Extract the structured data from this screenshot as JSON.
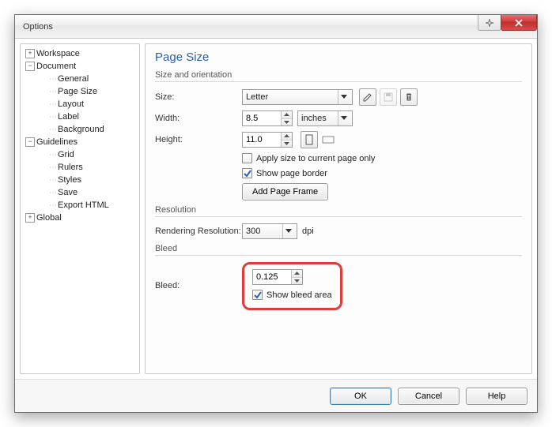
{
  "window": {
    "title": "Options"
  },
  "tree": {
    "workspace": {
      "label": "Workspace",
      "expanded": false
    },
    "document": {
      "label": "Document",
      "expanded": true,
      "children": [
        {
          "key": "general",
          "label": "General"
        },
        {
          "key": "page_size",
          "label": "Page Size"
        },
        {
          "key": "layout",
          "label": "Layout"
        },
        {
          "key": "label",
          "label": "Label"
        },
        {
          "key": "background",
          "label": "Background"
        }
      ]
    },
    "guidelines": {
      "label": "Guidelines",
      "expanded": true,
      "children": [
        {
          "key": "grid",
          "label": "Grid"
        },
        {
          "key": "rulers",
          "label": "Rulers"
        },
        {
          "key": "styles",
          "label": "Styles"
        },
        {
          "key": "save",
          "label": "Save"
        },
        {
          "key": "export_html",
          "label": "Export HTML"
        }
      ]
    },
    "global": {
      "label": "Global",
      "expanded": false
    }
  },
  "page": {
    "title": "Page Size",
    "size_group": "Size and orientation",
    "size_label": "Size:",
    "size_value": "Letter",
    "width_label": "Width:",
    "width_value": "8.5",
    "units_value": "inches",
    "height_label": "Height:",
    "height_value": "11.0",
    "apply_current_label": "Apply size to current page only",
    "apply_current_checked": false,
    "show_border_label": "Show page border",
    "show_border_checked": true,
    "add_frame_label": "Add Page Frame",
    "resolution_group": "Resolution",
    "rendering_label": "Rendering Resolution:",
    "rendering_value": "300",
    "rendering_unit": "dpi",
    "bleed_group": "Bleed",
    "bleed_label": "Bleed:",
    "bleed_value": "0.125",
    "show_bleed_label": "Show bleed area",
    "show_bleed_checked": true
  },
  "buttons": {
    "ok": "OK",
    "cancel": "Cancel",
    "help": "Help"
  }
}
